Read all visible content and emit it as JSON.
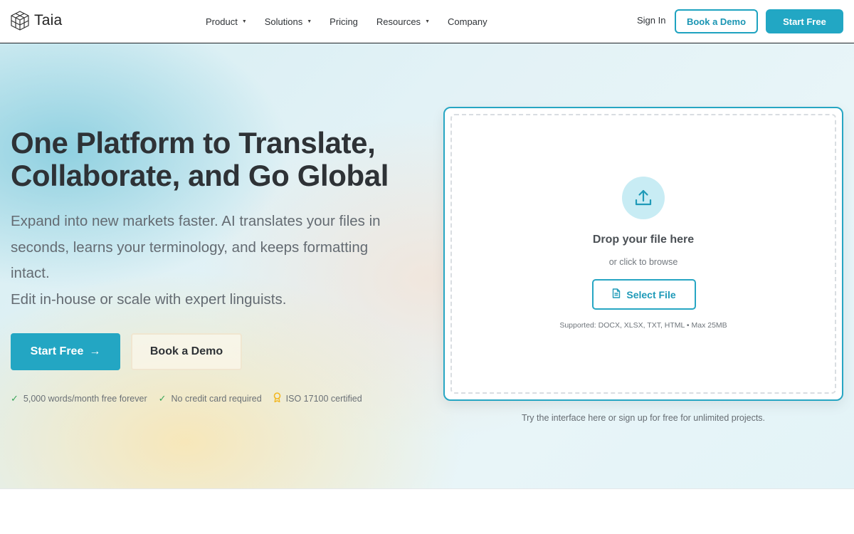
{
  "nav": {
    "logo_text": "Taia",
    "menu": [
      {
        "label": "Product",
        "has_dropdown": true
      },
      {
        "label": "Solutions",
        "has_dropdown": true
      },
      {
        "label": "Pricing",
        "has_dropdown": false
      },
      {
        "label": "Resources",
        "has_dropdown": true
      },
      {
        "label": "Company",
        "has_dropdown": false
      }
    ],
    "caret_glyph": "▼",
    "sign_in": "Sign In",
    "book_demo": "Book a Demo",
    "start_free": "Start Free"
  },
  "hero": {
    "headline": "One Platform to Translate, Collaborate, and Go Global",
    "subtext_line1": "Expand into new markets faster. AI translates your files in seconds, learns your terminology, and keeps formatting intact.",
    "subtext_line2": "Edit in-house or scale with expert linguists.",
    "start_free": "Start Free",
    "arrow_glyph": "→",
    "book_demo": "Book a Demo",
    "badges": [
      {
        "icon": "check-icon",
        "glyph": "✓",
        "text": "5,000 words/month free forever"
      },
      {
        "icon": "check-icon",
        "glyph": "✓",
        "text": "No credit card required"
      },
      {
        "icon": "medal-icon",
        "glyph": "♔",
        "text": "ISO 17100 certified"
      }
    ]
  },
  "upload": {
    "drop_title": "Drop your file here",
    "drop_sub": "or click to browse",
    "select_file": "Select File",
    "supported": "Supported: DOCX, XLSX, TXT, HTML • Max 25MB",
    "note": "Try the interface here or sign up for free for unlimited projects."
  },
  "colors": {
    "accent": "#22a7c4",
    "text_dark": "#2e3236",
    "text_muted": "#646b72",
    "check": "#3aa55a",
    "medal": "#f2b722"
  }
}
